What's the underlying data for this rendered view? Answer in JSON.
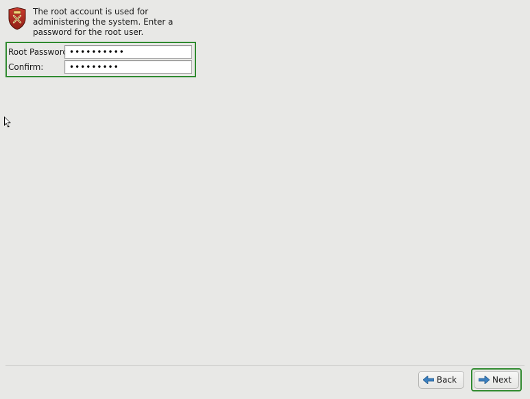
{
  "instruction": "The root account is used for administering the system.  Enter a password for the root user.",
  "form": {
    "root_password_label": "Root Password:",
    "confirm_label": "Confirm:",
    "root_password_value": "••••••••••",
    "confirm_value": "•••••••••"
  },
  "footer": {
    "back_label": "Back",
    "next_label": "Next"
  },
  "colors": {
    "highlight": "#2f8a2f",
    "arrow_blue": "#2e6fb3"
  },
  "icons": {
    "shield": "shield-icon",
    "arrow_left": "arrow-left-icon",
    "arrow_right": "arrow-right-icon"
  }
}
